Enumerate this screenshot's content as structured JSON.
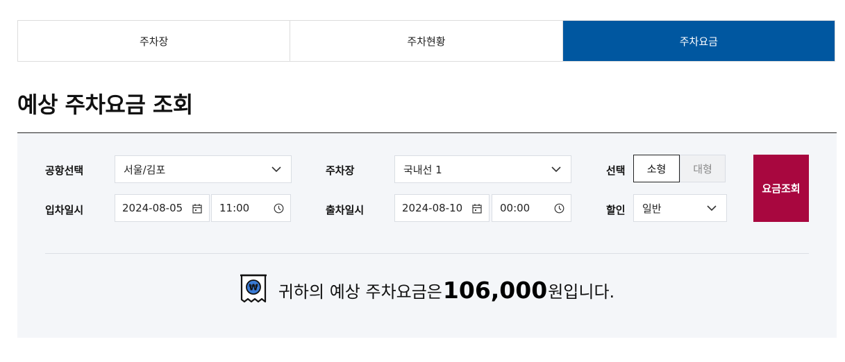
{
  "tabs": [
    {
      "label": "주차장",
      "active": false
    },
    {
      "label": "주차현황",
      "active": false
    },
    {
      "label": "주차요금",
      "active": true
    }
  ],
  "page_title": "예상 주차요금 조회",
  "form": {
    "airport": {
      "label": "공항선택",
      "value": "서울/김포"
    },
    "parking_lot": {
      "label": "주차장",
      "value": "국내선 1"
    },
    "vehicle": {
      "label": "선택",
      "options": [
        "소형",
        "대형"
      ],
      "selected": "소형"
    },
    "entry": {
      "label": "입차일시",
      "date": "2024-08-05",
      "time": "11:00"
    },
    "exit": {
      "label": "출차일시",
      "date": "2024-08-10",
      "time": "00:00"
    },
    "discount": {
      "label": "할인",
      "value": "일반"
    },
    "search_button": "요금조회"
  },
  "result": {
    "prefix": "귀하의 예상 주차요금은 ",
    "amount": "106,000",
    "suffix": "원입니다."
  },
  "colors": {
    "active_tab": "#0057a0",
    "search_button": "#a8073f",
    "panel_bg": "#f4f6f9"
  },
  "icons": [
    "chevron-down-icon",
    "calendar-icon",
    "clock-icon",
    "receipt-won-icon"
  ]
}
